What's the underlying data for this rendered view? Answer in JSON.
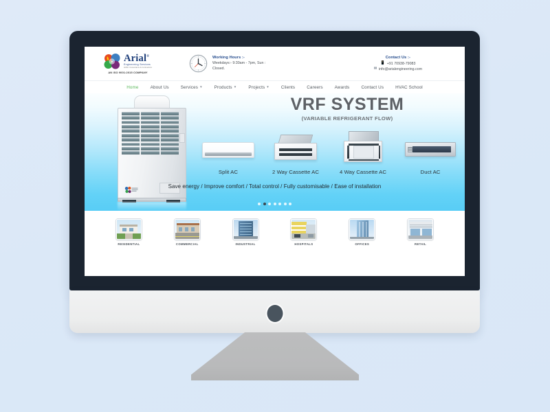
{
  "page": {
    "background_color": "#dce9f7",
    "device": "imac-style-monitor-mockup"
  },
  "monitor": {
    "bezel_color": "#1b2430",
    "chin_color": "#eceded",
    "stand_color": "#b9babb",
    "power_button_name": "monitor-power-button"
  },
  "site": {
    "header": {
      "logo": {
        "name": "Arial",
        "trademark": "®",
        "tagline1": "Engineering Services",
        "tagline2": "HVAC Consultants & Contractors",
        "iso": "AN ISO 9001:2015 COMPANY"
      },
      "hours": {
        "icon": "clock-icon",
        "title": "Working Hours :-",
        "line1": "Weekdays:- 9:30am - 7pm, Sun :",
        "line2": "Closed."
      },
      "contact": {
        "title": "Contact Us :-",
        "phone_icon": "phone-icon",
        "phone": "+91 70938-79083",
        "email_icon": "envelope-icon",
        "email": "info@arialengineering.com"
      }
    },
    "nav": {
      "active_color": "#5cb85c",
      "items": [
        {
          "label": "Home",
          "active": true,
          "dropdown": false
        },
        {
          "label": "About Us",
          "active": false,
          "dropdown": false
        },
        {
          "label": "Services",
          "active": false,
          "dropdown": true
        },
        {
          "label": "Products",
          "active": false,
          "dropdown": true
        },
        {
          "label": "Projects",
          "active": false,
          "dropdown": true
        },
        {
          "label": "Clients",
          "active": false,
          "dropdown": false
        },
        {
          "label": "Careers",
          "active": false,
          "dropdown": false
        },
        {
          "label": "Awards",
          "active": false,
          "dropdown": false
        },
        {
          "label": "Contact Us",
          "active": false,
          "dropdown": false
        },
        {
          "label": "HVAC School",
          "active": false,
          "dropdown": false
        }
      ]
    },
    "hero": {
      "title": "VRF SYSTEM",
      "subtitle": "(VARIABLE REFRIGERANT FLOW)",
      "outdoor_unit": "vrf-outdoor-unit",
      "products": [
        {
          "label": "Split AC",
          "icon": "split-ac-icon"
        },
        {
          "label": "2 Way Cassette AC",
          "icon": "two-way-cassette-ac-icon"
        },
        {
          "label": "4 Way Cassette AC",
          "icon": "four-way-cassette-ac-icon"
        },
        {
          "label": "Duct AC",
          "icon": "duct-ac-icon"
        }
      ],
      "tagline": "Save energy / Improve comfort / Total control / Fully customisable / Ease of installation",
      "carousel": {
        "total": 7,
        "active_index": 1
      }
    },
    "categories": [
      {
        "label": "RESIDENTIAL",
        "thumb": "residential-house-thumbnail"
      },
      {
        "label": "COMMERCIAL",
        "thumb": "commercial-building-thumbnail"
      },
      {
        "label": "INDUSTRIAL",
        "thumb": "industrial-tower-thumbnail"
      },
      {
        "label": "HOSPITALS",
        "thumb": "hospital-building-thumbnail"
      },
      {
        "label": "OFFICES",
        "thumb": "office-skyscraper-thumbnail"
      },
      {
        "label": "RETAIL",
        "thumb": "retail-storefront-thumbnail"
      }
    ]
  }
}
